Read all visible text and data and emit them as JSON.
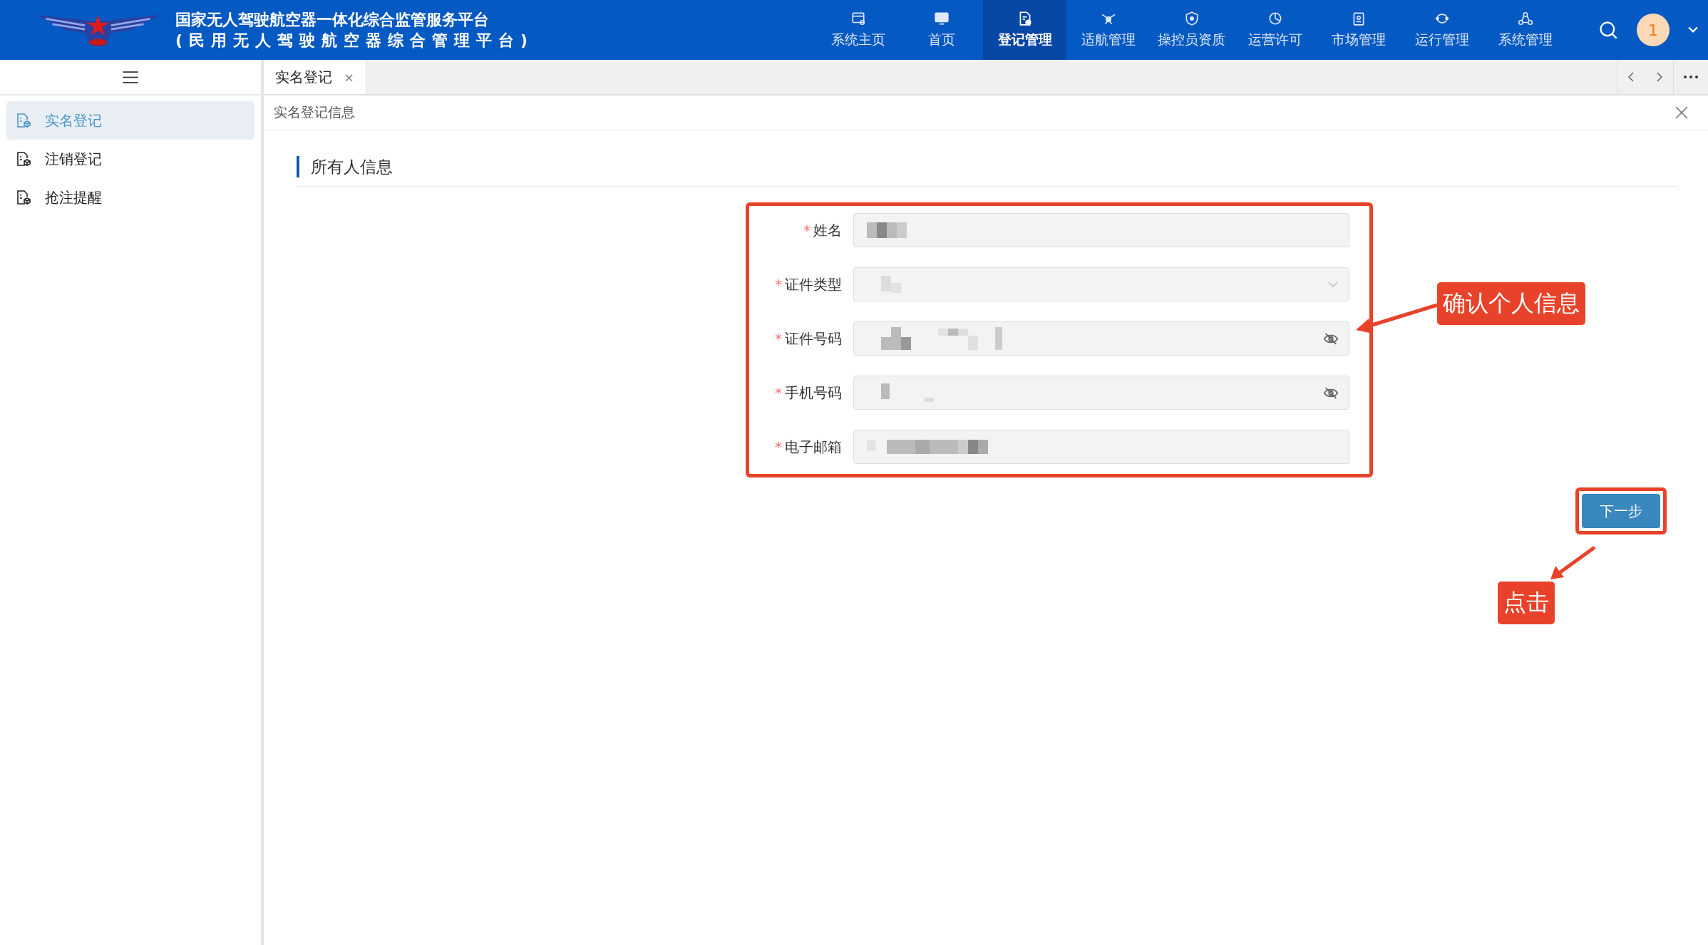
{
  "header": {
    "title": "国家无人驾驶航空器一体化综合监管服务平台",
    "subtitle": "(民用无人驾驶航空器综合管理平台)",
    "avatar": "1",
    "nav": [
      {
        "label": "系统主页",
        "selected": false
      },
      {
        "label": "首页",
        "selected": false
      },
      {
        "label": "登记管理",
        "selected": true
      },
      {
        "label": "适航管理",
        "selected": false
      },
      {
        "label": "操控员资质",
        "selected": false
      },
      {
        "label": "运营许可",
        "selected": false
      },
      {
        "label": "市场管理",
        "selected": false
      },
      {
        "label": "运行管理",
        "selected": false
      },
      {
        "label": "系统管理",
        "selected": false
      }
    ]
  },
  "sidebar": {
    "items": [
      {
        "label": "实名登记",
        "selected": true
      },
      {
        "label": "注销登记",
        "selected": false
      },
      {
        "label": "抢注提醒",
        "selected": false
      }
    ]
  },
  "tabs": [
    {
      "label": "实名登记",
      "close": "×",
      "selected": true
    }
  ],
  "panel": {
    "title": "实名登记信息",
    "section": "所有人信息",
    "fields": [
      {
        "label": "姓名",
        "required_mark": "*",
        "kind": "text"
      },
      {
        "label": "证件类型",
        "required_mark": "*",
        "kind": "select"
      },
      {
        "label": "证件号码",
        "required_mark": "*",
        "kind": "secret"
      },
      {
        "label": "手机号码",
        "required_mark": "*",
        "kind": "secret"
      },
      {
        "label": "电子邮箱",
        "required_mark": "*",
        "kind": "text"
      }
    ]
  },
  "next_button": "下一步",
  "annotations": [
    {
      "text": "确认个人信息"
    },
    {
      "text": "点击"
    }
  ]
}
